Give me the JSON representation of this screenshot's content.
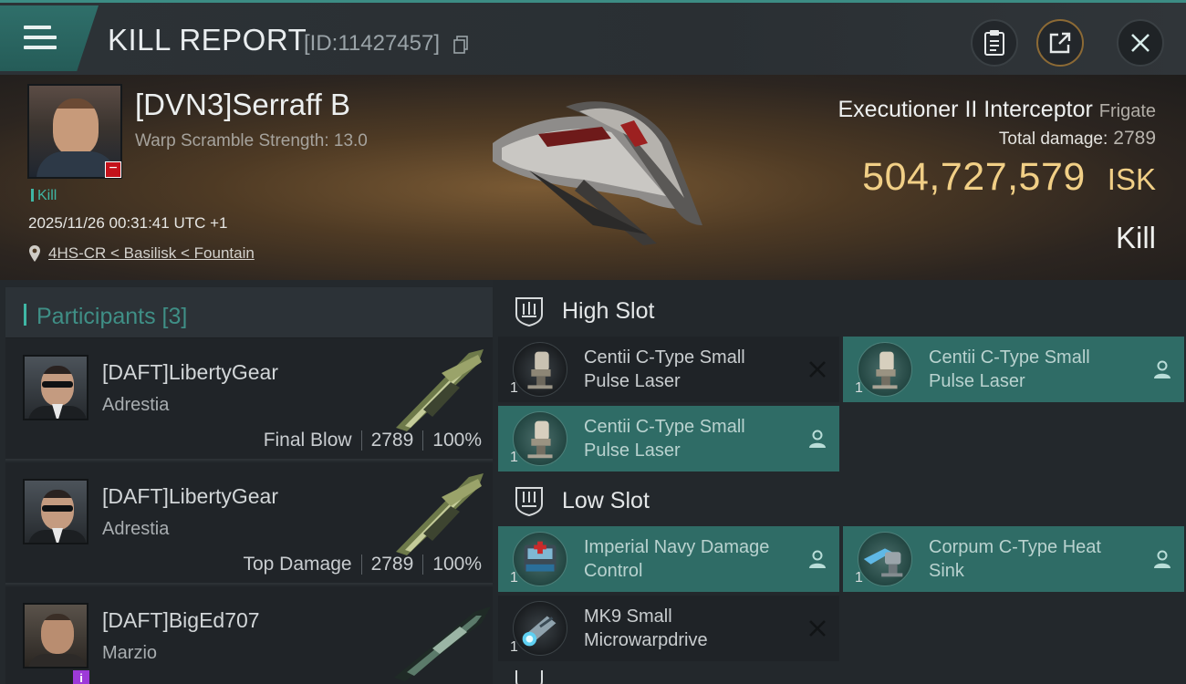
{
  "header": {
    "title": "KILL REPORT",
    "report_id": "[ID:11427457]",
    "icons": {
      "menu": "hamburger-menu-icon",
      "copy": "copy-icon",
      "clipboard": "clipboard-icon",
      "share": "share-icon",
      "close": "close-icon"
    }
  },
  "victim": {
    "name": "[DVN3]Serraff B",
    "warp_scramble": "Warp Scramble Strength: 13.0",
    "kill_tag": "Kill",
    "datetime": "2025/11/26 00:31:41 UTC +1",
    "location": "4HS-CR < Basilisk < Fountain",
    "ship_name": "Executioner II Interceptor",
    "ship_class": "Frigate",
    "total_damage_label": "Total damage:",
    "total_damage_value": "2789",
    "isk_value": "504,727,579",
    "isk_unit": "ISK",
    "result": "Kill"
  },
  "participants": {
    "title": "Participants [3]",
    "rows": [
      {
        "name": "[DAFT]LibertyGear",
        "sub": "Adrestia",
        "role": "Final Blow",
        "damage": "2789",
        "percent": "100%"
      },
      {
        "name": "[DAFT]LibertyGear",
        "sub": "Adrestia",
        "role": "Top Damage",
        "damage": "2789",
        "percent": "100%"
      },
      {
        "name": "[DAFT]BigEd707",
        "sub": "Marzio"
      }
    ]
  },
  "slots": {
    "high_label": "High Slot",
    "low_label": "Low Slot",
    "high": [
      {
        "name": "Centii C-Type Small Pulse Laser",
        "qty": "1",
        "state": "destroyed",
        "state_icon": "x-icon"
      },
      {
        "name": "Centii C-Type Small Pulse Laser",
        "qty": "1",
        "state": "dropped",
        "state_icon": "person-icon"
      },
      {
        "name": "Centii C-Type Small Pulse Laser",
        "qty": "1",
        "state": "dropped",
        "state_icon": "person-icon"
      }
    ],
    "low": [
      {
        "name": "Imperial Navy Damage Control",
        "qty": "1",
        "state": "dropped",
        "state_icon": "person-icon"
      },
      {
        "name": "Corpum C-Type Heat Sink",
        "qty": "1",
        "state": "dropped",
        "state_icon": "person-icon"
      },
      {
        "name": "MK9 Small Microwarpdrive",
        "qty": "1",
        "state": "destroyed",
        "state_icon": "x-icon"
      }
    ]
  },
  "colors": {
    "accent": "#3fb7a5",
    "isk_gold": "#f1cf86",
    "active_module": "#2f6c66",
    "badge_red": "#c3121b",
    "badge_purple": "#9d3ad8"
  }
}
